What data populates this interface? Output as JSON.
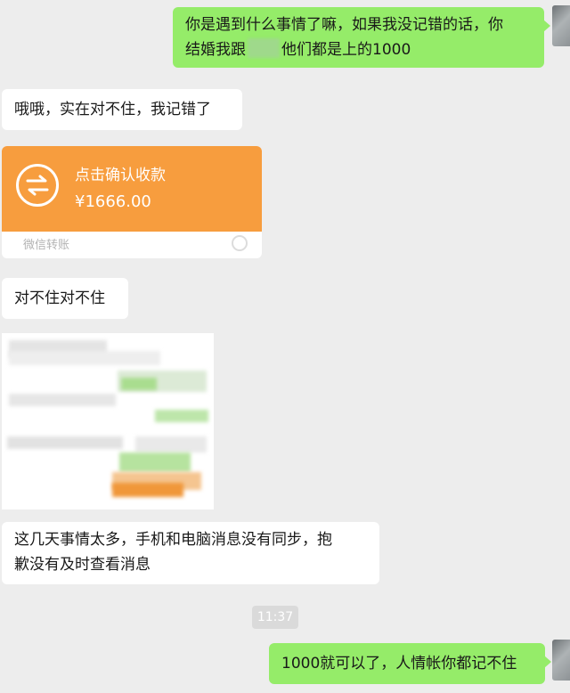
{
  "messages": {
    "m1": "你是遇到什么事情了嘛，如果我没记错的话，你",
    "m1b_pre": "结婚我跟",
    "m1b_post": "他们都是上的1000",
    "m2": "哦哦，实在对不住，我记错了",
    "m3": "对不住对不住",
    "m4a": "这几天事情太多，手机和电脑消息没有同步，抱",
    "m4b": "歉没有及时查看消息",
    "m5": "1000就可以了，人情帐你都记不住"
  },
  "transfer": {
    "status": "点击确认收款",
    "amount": "¥1666.00",
    "footer": "微信转账",
    "color": "#f79d3e"
  },
  "timestamp": "11:37",
  "colors": {
    "background": "#ededed",
    "outgoing": "#95ec69",
    "incoming": "#ffffff"
  }
}
